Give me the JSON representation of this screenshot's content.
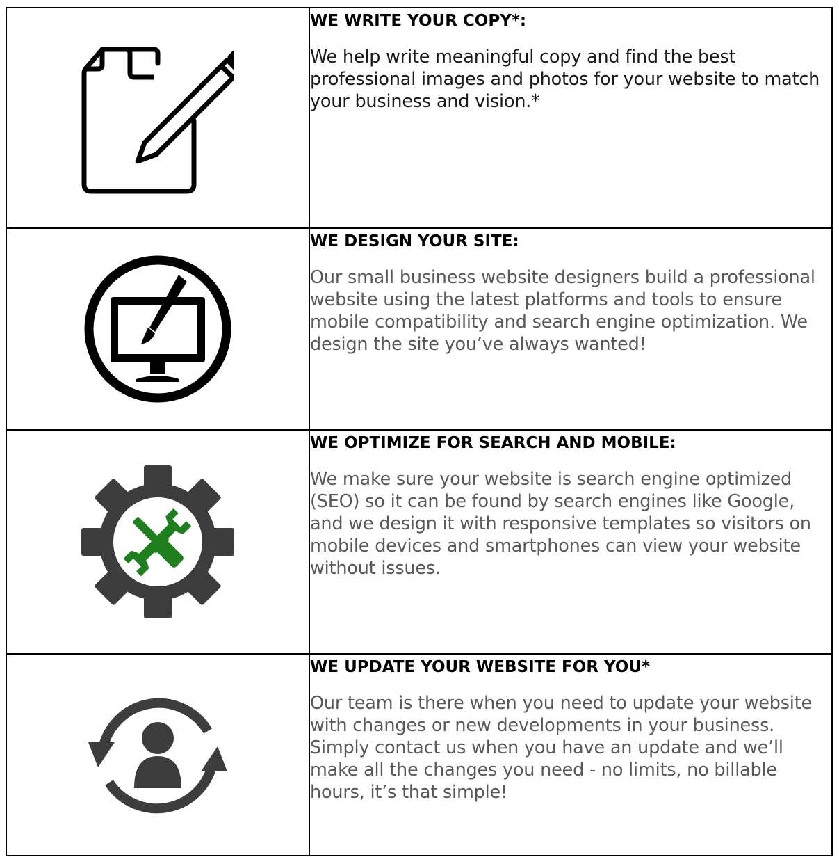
{
  "services": [
    {
      "icon": "document-pencil-icon",
      "title": "WE WRITE YOUR COPY*:",
      "description": "We help write meaningful copy and find the best professional images and photos for your website to match your business and vision.*"
    },
    {
      "icon": "monitor-brush-icon",
      "title": "WE DESIGN YOUR SITE:",
      "description": "Our small business website designers build a professional website using the latest platforms and tools to ensure mobile compatibility and search engine optimization.  We design the site you’ve always wanted!"
    },
    {
      "icon": "gear-tools-icon",
      "title": "WE OPTIMIZE FOR SEARCH AND MOBILE:",
      "description": "We make sure your website is search engine optimized (SEO) so it can be found by search engines like Google, and we design it with responsive templates so visitors on mobile devices and  smartphones can view your website without issues."
    },
    {
      "icon": "user-sync-icon",
      "title": "WE UPDATE YOUR WEBSITE FOR YOU*",
      "description": "Our team is there when you need to update your website with changes or new developments in your business.  Simply contact us when you have an update and we’ll make all the changes you need - no limits, no billable hours, it’s that simple!"
    }
  ],
  "colors": {
    "border": "#000000",
    "icon_dark": "#3d3d3d",
    "icon_green": "#1f7f1f",
    "text_dark": "#1a1a1a",
    "text_grey": "#595959"
  }
}
